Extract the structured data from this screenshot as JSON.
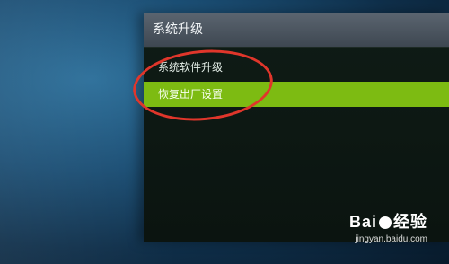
{
  "panel": {
    "title": "系统升级",
    "items": [
      {
        "label": "系统软件升级",
        "selected": false
      },
      {
        "label": "恢复出厂设置",
        "selected": true
      }
    ],
    "selection_color": "#7dbb12"
  },
  "annotation": {
    "shape": "ellipse",
    "color": "#e0362b"
  },
  "watermark": {
    "brand_left": "Bai",
    "brand_right": "经验",
    "url": "jingyan.baidu.com"
  }
}
